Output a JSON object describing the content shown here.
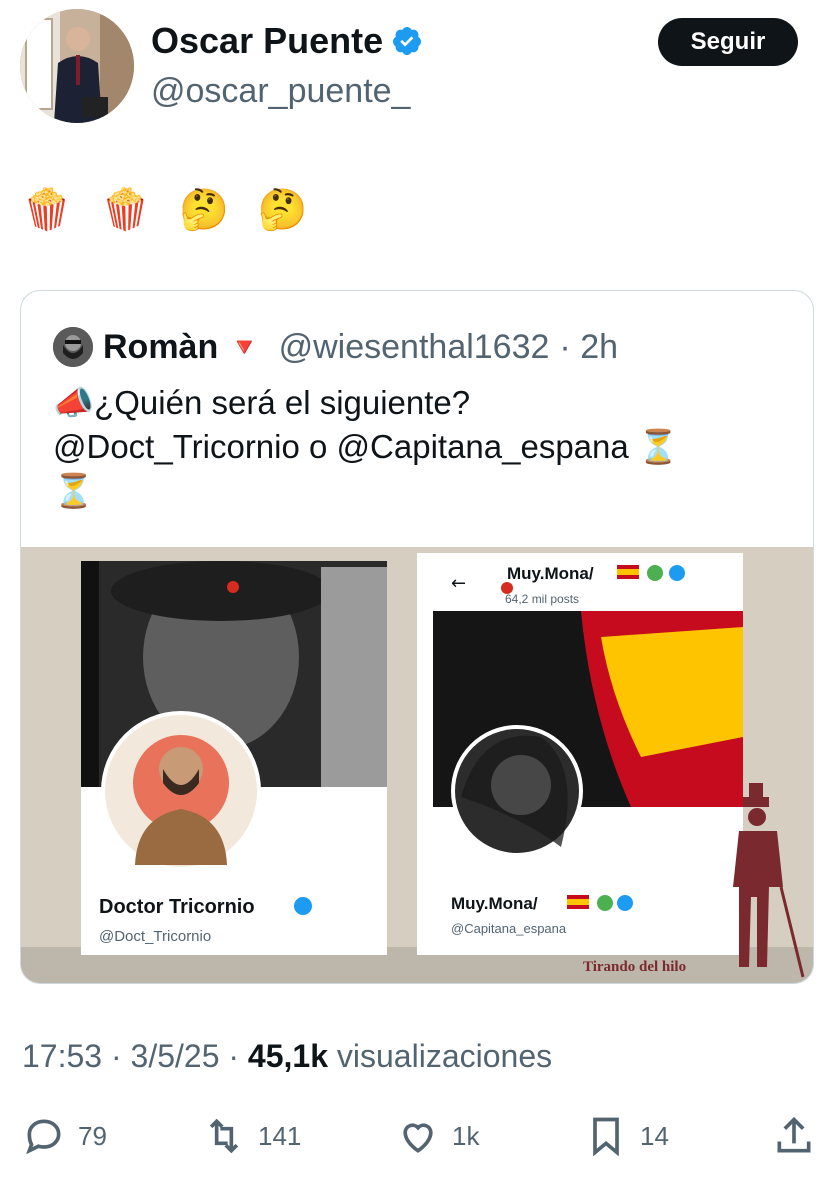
{
  "author": {
    "name": "Oscar Puente",
    "handle": "@oscar_puente_",
    "follow_label": "Seguir"
  },
  "tweet": {
    "text": "🍿 🍿 🤔 🤔"
  },
  "quote": {
    "name": "Romàn",
    "flag": "🔻",
    "handle": "@wiesenthal1632",
    "time": "· 2h",
    "text_line1": "📣¿Quién será el siguiente?",
    "text_line2": "@Doct_Tricornio o @Capitana_espana ⏳",
    "text_line3": "⏳",
    "image": {
      "left_card": {
        "name": "Doctor Tricornio",
        "handle": "@Doct_Tricornio"
      },
      "right_card": {
        "top_name": "Muy.Mona/",
        "top_posts": "64,2 mil posts",
        "name": "Muy.Mona/",
        "handle": "@Capitana_espana"
      },
      "caption": "Tirando del hilo"
    }
  },
  "meta": {
    "time": "17:53",
    "date": "3/5/25",
    "views_count": "45,1k",
    "views_label": "visualizaciones"
  },
  "actions": {
    "replies": "79",
    "reposts": "141",
    "likes": "1k",
    "bookmarks": "14"
  },
  "colors": {
    "verified": "#1d9bf0",
    "text": "#0f1419",
    "secondary": "#536471"
  }
}
